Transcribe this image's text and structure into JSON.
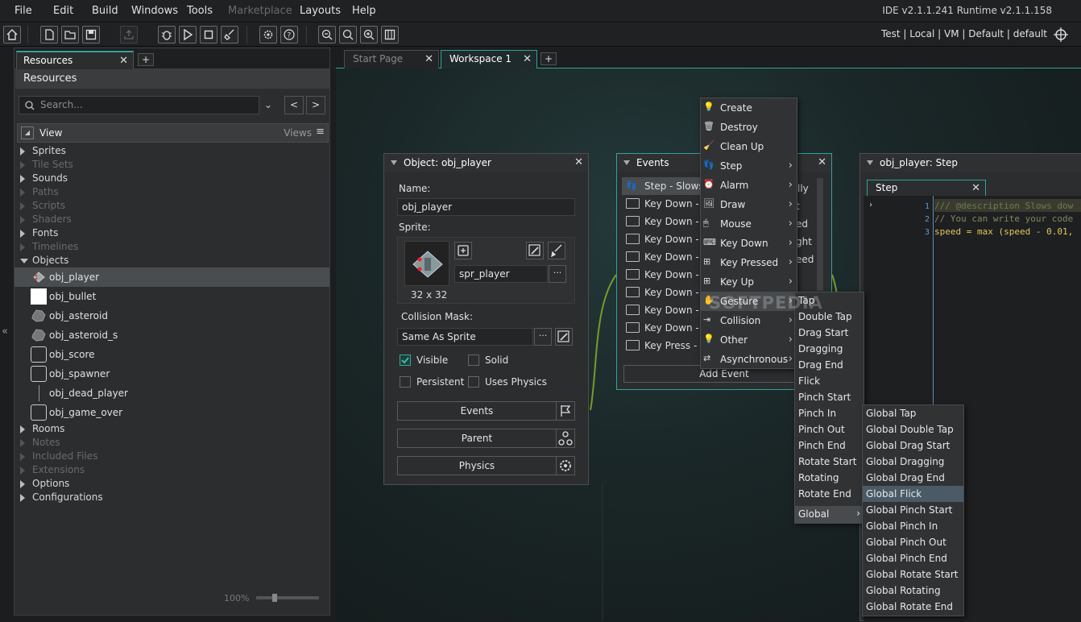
{
  "menubar": {
    "items": [
      "File",
      "Edit",
      "Build",
      "Windows",
      "Tools",
      "Marketplace",
      "Layouts",
      "Help"
    ],
    "version": "IDE v2.1.1.241 Runtime v2.1.1.158"
  },
  "toolbar": {
    "targets": "Test  |  Local  |  VM  |  Default  |  default"
  },
  "resources": {
    "tab_label": "Resources",
    "title": "Resources",
    "search_placeholder": "Search...",
    "view_label": "View",
    "views_label": "Views",
    "tree": [
      {
        "label": "Sprites",
        "dim": false
      },
      {
        "label": "Tile Sets",
        "dim": true
      },
      {
        "label": "Sounds",
        "dim": false
      },
      {
        "label": "Paths",
        "dim": true
      },
      {
        "label": "Scripts",
        "dim": true
      },
      {
        "label": "Shaders",
        "dim": true
      },
      {
        "label": "Fonts",
        "dim": false
      },
      {
        "label": "Timelines",
        "dim": true
      },
      {
        "label": "Objects",
        "dim": false
      }
    ],
    "objects": [
      "obj_player",
      "obj_bullet",
      "obj_asteroid",
      "obj_asteroid_s",
      "obj_score",
      "obj_spawner",
      "obj_dead_player",
      "obj_game_over"
    ],
    "tree_after": [
      {
        "label": "Rooms",
        "dim": false
      },
      {
        "label": "Notes",
        "dim": true
      },
      {
        "label": "Included Files",
        "dim": true
      },
      {
        "label": "Extensions",
        "dim": true
      },
      {
        "label": "Options",
        "dim": false
      },
      {
        "label": "Configurations",
        "dim": false
      }
    ],
    "zoom": "100%"
  },
  "workspace": {
    "tabs": [
      "Start Page",
      "Workspace 1"
    ]
  },
  "object_editor": {
    "title": "Object: obj_player",
    "name_label": "Name:",
    "name_value": "obj_player",
    "sprite_label": "Sprite:",
    "sprite_value": "spr_player",
    "sprite_size": "32 x 32",
    "collision_label": "Collision Mask:",
    "collision_value": "Same As Sprite",
    "visible_label": "Visible",
    "solid_label": "Solid",
    "persistent_label": "Persistent",
    "physics_chk_label": "Uses Physics",
    "events_btn": "Events",
    "parent_btn": "Parent",
    "physics_btn": "Physics"
  },
  "events_panel": {
    "title": "Events",
    "items": [
      "Step - Slows",
      "Key Down - L",
      "Key Down - U",
      "Key Down - F",
      "Key Down - D",
      "Key Down - A",
      "Key Down - D",
      "Key Down - S",
      "Key Down - W",
      "Key Press - S"
    ],
    "right_fragments": [
      "lly",
      "t",
      "ed",
      "ght",
      "eed"
    ],
    "add_event": "Add Event"
  },
  "event_menu": {
    "items": [
      "Create",
      "Destroy",
      "Clean Up",
      "Step",
      "Alarm",
      "Draw",
      "Mouse",
      "Key Down",
      "Key Pressed",
      "Key Up",
      "Gesture",
      "Collision",
      "Other",
      "Asynchronous"
    ],
    "submenu_flags": [
      false,
      false,
      false,
      true,
      true,
      true,
      true,
      true,
      true,
      true,
      true,
      true,
      true,
      true
    ]
  },
  "gesture_menu": {
    "items": [
      "Tap",
      "Double Tap",
      "Drag Start",
      "Dragging",
      "Drag End",
      "Flick",
      "Pinch Start",
      "Pinch In",
      "Pinch Out",
      "Pinch End",
      "Rotate Start",
      "Rotating",
      "Rotate End",
      "Global"
    ]
  },
  "global_menu": {
    "items": [
      "Global Tap",
      "Global Double Tap",
      "Global Drag Start",
      "Global Dragging",
      "Global Drag End",
      "Global Flick",
      "Global Pinch Start",
      "Global Pinch In",
      "Global Pinch Out",
      "Global Pinch End",
      "Global Rotate Start",
      "Global Rotating",
      "Global Rotate End"
    ],
    "highlighted": "Global Flick"
  },
  "code_editor": {
    "title": "obj_player: Step",
    "tab": "Step",
    "lines": [
      {
        "n": "1",
        "text": "/// @description Slows dow"
      },
      {
        "n": "2",
        "text": "// You can write your code"
      },
      {
        "n": "3",
        "text": "speed = max (speed - 0.01,"
      }
    ]
  },
  "watermark": "SOFTPEDIA",
  "colors": {
    "accent": "#2fa39b",
    "selection": "#4a4d50",
    "menu_highlight": "#4a5a66"
  }
}
